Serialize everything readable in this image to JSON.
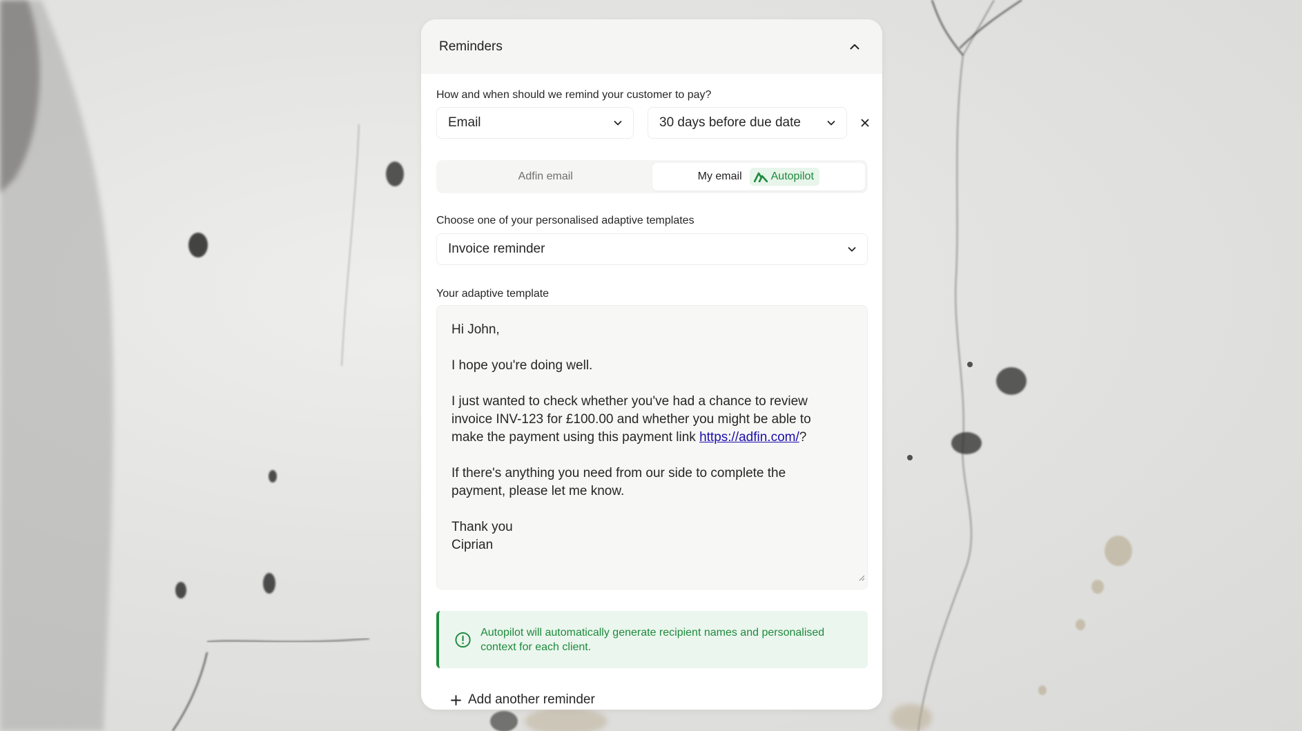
{
  "header": {
    "title": "Reminders",
    "collapse_icon": "chevron-up-icon"
  },
  "reminder": {
    "question_label": "How and when should we remind your customer to pay?",
    "method": "Email",
    "timing": "30 days before due date",
    "remove_icon": "close-icon"
  },
  "email_tabs": {
    "adfin_label": "Adfin email",
    "my_label": "My email",
    "active": "My email",
    "badge_label": "Autopilot",
    "badge_icon": "autopilot-icon"
  },
  "template_select": {
    "label": "Choose one of your personalised adaptive templates",
    "value": "Invoice reminder"
  },
  "template": {
    "label": "Your adaptive template",
    "greeting": "Hi John,",
    "line1": "I hope you're doing well.",
    "line2a": "I just wanted to check whether you've had a chance to review",
    "line2b": "invoice INV-123 for £100.00 and whether you might be able to",
    "line2c": "make the payment using this payment link ",
    "link": "https://adfin.com/",
    "line2d": "?",
    "line3a": "If there's anything you need from our side to complete the",
    "line3b": "payment, please let me know.",
    "signoff": "Thank you",
    "signature": "Ciprian"
  },
  "alert": {
    "icon": "info-icon",
    "text": "Autopilot will automatically generate recipient names and personalised context for each client."
  },
  "add_button": {
    "label": "Add another reminder",
    "icon": "plus-icon"
  },
  "colors": {
    "accent_green": "#1e8a3c",
    "alert_bg": "#ebf6ee",
    "link": "#1a0dab"
  }
}
